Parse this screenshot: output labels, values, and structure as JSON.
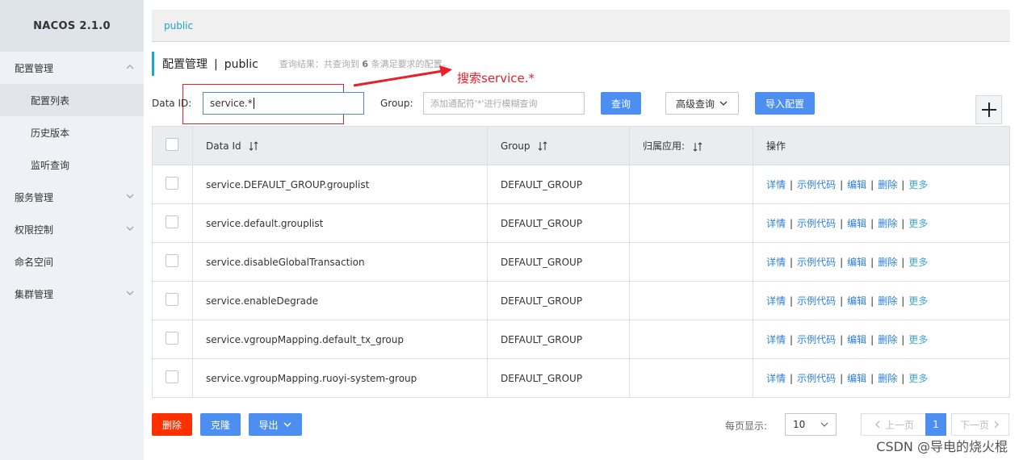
{
  "sidebar": {
    "brand": "NACOS 2.1.0",
    "items": [
      {
        "label": "配置管理",
        "expanded": true
      },
      {
        "label": "配置列表",
        "sub": true,
        "active": true
      },
      {
        "label": "历史版本",
        "sub": true
      },
      {
        "label": "监听查询",
        "sub": true
      },
      {
        "label": "服务管理",
        "expanded": false
      },
      {
        "label": "权限控制",
        "expanded": false
      },
      {
        "label": "命名空间"
      },
      {
        "label": "集群管理",
        "expanded": false
      }
    ]
  },
  "namespace_tab": "public",
  "header": {
    "title": "配置管理",
    "separator": "|",
    "namespace": "public",
    "result_prefix": "查询结果：共查询到",
    "result_count": "6",
    "result_suffix": "条满足要求的配置。"
  },
  "annotation": "搜索service.*",
  "search": {
    "data_id_label": "Data ID:",
    "data_id_value": "service.*",
    "group_label": "Group:",
    "group_placeholder": "添加通配符'*'进行模糊查询",
    "query_button": "查询",
    "advanced_button": "高级查询",
    "import_button": "导入配置"
  },
  "table": {
    "headers": [
      "Data Id",
      "Group",
      "归属应用:",
      "操作"
    ],
    "rows": [
      {
        "data_id": "service.DEFAULT_GROUP.grouplist",
        "group": "DEFAULT_GROUP",
        "app": ""
      },
      {
        "data_id": "service.default.grouplist",
        "group": "DEFAULT_GROUP",
        "app": ""
      },
      {
        "data_id": "service.disableGlobalTransaction",
        "group": "DEFAULT_GROUP",
        "app": ""
      },
      {
        "data_id": "service.enableDegrade",
        "group": "DEFAULT_GROUP",
        "app": ""
      },
      {
        "data_id": "service.vgroupMapping.default_tx_group",
        "group": "DEFAULT_GROUP",
        "app": ""
      },
      {
        "data_id": "service.vgroupMapping.ruoyi-system-group",
        "group": "DEFAULT_GROUP",
        "app": ""
      }
    ],
    "ops": {
      "detail": "详情",
      "sample": "示例代码",
      "edit": "编辑",
      "delete": "删除",
      "more": "更多",
      "sep": "|"
    }
  },
  "footer": {
    "delete_button": "删除",
    "clone_button": "克隆",
    "export_button": "导出",
    "page_size_label": "每页显示:",
    "page_size": "10",
    "prev": "上一页",
    "current_page": "1",
    "next": "下一页"
  },
  "watermark": "CSDN @导电的烧火棍",
  "colors": {
    "accent": "#4c8ff0",
    "danger": "#ff3000",
    "link": "#2a7fd4",
    "annotation": "#e8202a"
  }
}
